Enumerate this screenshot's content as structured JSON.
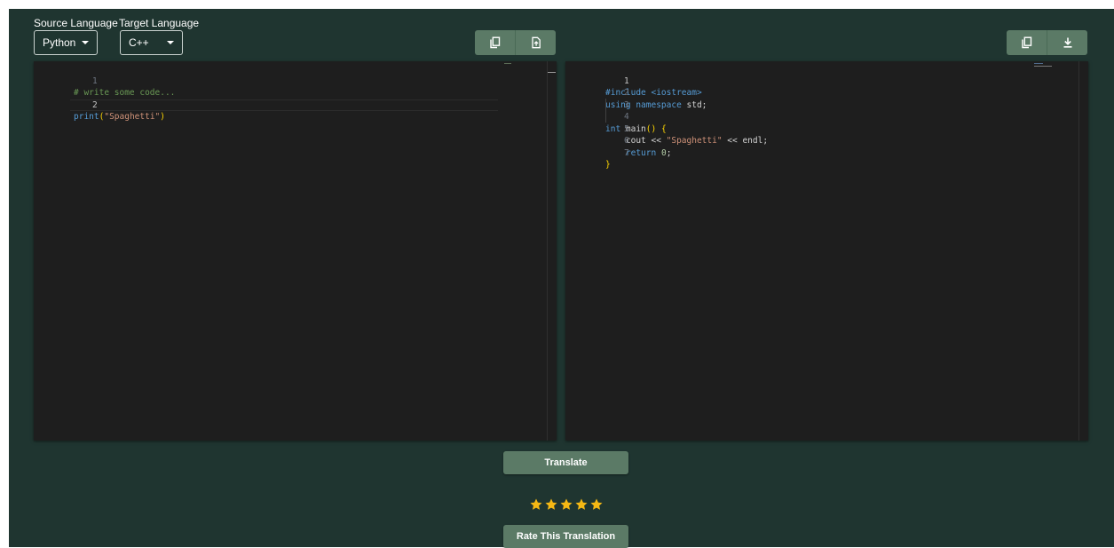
{
  "controls": {
    "source_label": "Source Language",
    "target_label": "Target Language",
    "source_value": "Python",
    "target_value": "C++"
  },
  "source_editor": {
    "lines": [
      {
        "number": "1",
        "parts": [
          "# write some code..."
        ]
      },
      {
        "number": "2",
        "parts": [
          "print",
          "(",
          "\"Spaghetti\"",
          ")"
        ]
      }
    ]
  },
  "target_editor": {
    "lines": [
      {
        "number": "1",
        "parts": [
          "#include <iostream>"
        ]
      },
      {
        "number": "2",
        "parts": [
          "using namespace",
          " std;"
        ]
      },
      {
        "number": "3",
        "parts": [
          ""
        ]
      },
      {
        "number": "4",
        "parts": [
          "int",
          " main",
          "()",
          " {"
        ]
      },
      {
        "number": "5",
        "parts": [
          "    cout << ",
          "\"Spaghetti\"",
          " << endl;"
        ]
      },
      {
        "number": "6",
        "parts": [
          "    ",
          "return",
          " ",
          "0",
          ";"
        ]
      },
      {
        "number": "7",
        "parts": [
          "}"
        ]
      }
    ]
  },
  "actions": {
    "translate_label": "Translate",
    "rate_label": "Rate This Translation"
  },
  "rating": {
    "stars": 5,
    "max": 5
  },
  "colors": {
    "background": "#1f3530",
    "button": "#5b7a66",
    "editor": "#1e1e1e",
    "star": "#f5b814"
  },
  "icons": {
    "source_copy": "copy-icon",
    "source_upload": "upload-file-icon",
    "target_copy": "copy-icon",
    "target_download": "download-icon",
    "rating": "star-icon"
  }
}
